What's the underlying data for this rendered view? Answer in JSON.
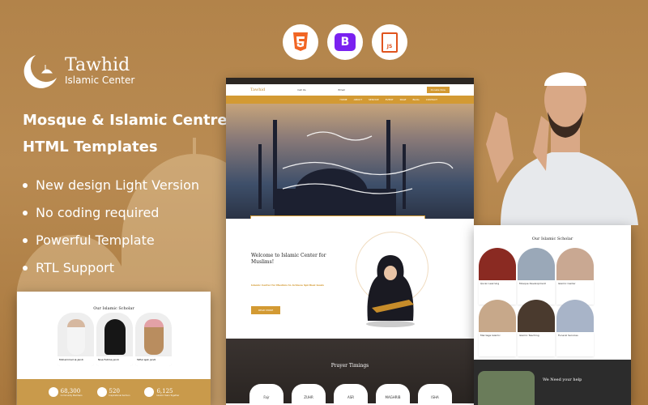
{
  "brand": {
    "name": "Tawhid",
    "tagline": "Islamic Center"
  },
  "headline": {
    "line1": "Mosque & Islamic Centre",
    "line2": "HTML Templates"
  },
  "features": [
    "New design Light Version",
    "No coding required",
    "Powerful Template",
    "RTL Support"
  ],
  "tech_icons": [
    "html5-icon",
    "bootstrap-icon",
    "javascript-file-icon"
  ],
  "tech_labels": {
    "bootstrap": "B",
    "js": "JS"
  },
  "colors": {
    "accent": "#d39a33",
    "dark": "#2b2622",
    "bg": "#b2834a"
  },
  "center_mock": {
    "nav": [
      "HOME",
      "ABOUT",
      "SERVICE",
      "EVENT",
      "PAGE",
      "BLOG",
      "CONTACT"
    ],
    "donate": "Donate Now",
    "call_label": "Call Us",
    "email_label": "Email",
    "welcome_title": "Welcome to Islamic Center for Muslims!",
    "welcome_sub": "Islamic Center for Muslims to Achieve Spiritual Goals",
    "read_more": "READ MORE",
    "prayer_title": "Prayer Timings",
    "prayers": [
      "Fajr",
      "ZUHR",
      "ASR",
      "MAGHRIB",
      "ISHA"
    ]
  },
  "left_mock": {
    "title": "Our Islamic Scholar",
    "scholars": [
      {
        "name": "Mohammad al-Jandi"
      },
      {
        "name": "Nisa Fatima jandi"
      },
      {
        "name": "Tafiel ajak jandi"
      }
    ],
    "stats": [
      {
        "value": "68,300",
        "label": "Community Members"
      },
      {
        "value": "520",
        "label": "Inspirational Sermon"
      },
      {
        "value": "6,125",
        "label": "Islamic Years Together"
      }
    ]
  },
  "right_mock": {
    "title": "Our Islamic Scholar",
    "services": [
      "Quran Learning",
      "Mosque Development",
      "Islamic Center",
      "Marriage Islamic",
      "Islamic Teaching",
      "Funeral Services"
    ],
    "help_title": "We Need your help"
  }
}
